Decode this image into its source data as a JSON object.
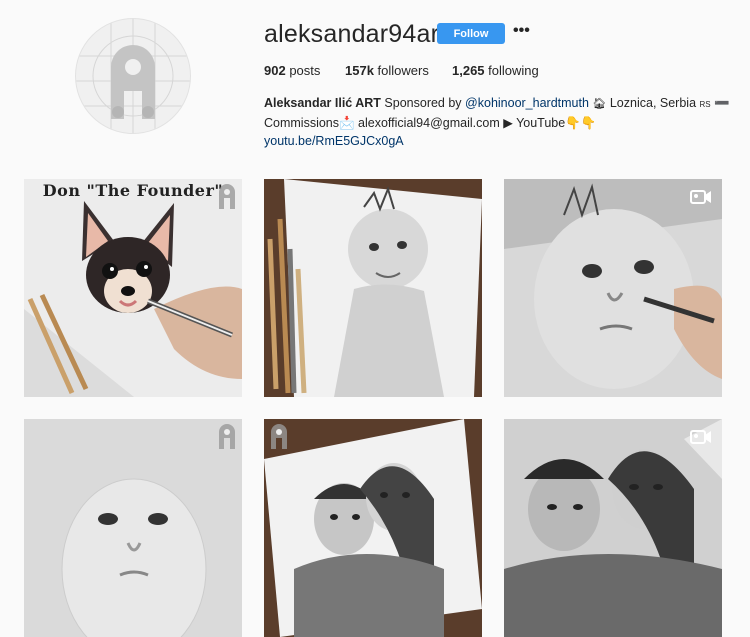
{
  "profile": {
    "username": "aleksandar94art",
    "follow_label": "Follow",
    "more_label": "•••",
    "stats": {
      "posts_count": "902",
      "posts_label": "posts",
      "followers_count": "157k",
      "followers_label": "followers",
      "following_count": "1,265",
      "following_label": "following"
    },
    "bio": {
      "name": "Aleksandar Ilić ART",
      "sponsored_text": "Sponsored by",
      "sponsor_tag": "@kohinoor_hardtmuth",
      "location": "Loznica, Serbia",
      "line2": "Commissions📩 alexofficial94@gmail.com ▶ YouTube👇👇",
      "link": "youtu.be/RmE5GJCx0gA"
    }
  },
  "posts": [
    {
      "type": "image",
      "subject": "chihuahua drawing",
      "caption": "Don \"The Founder\""
    },
    {
      "type": "image",
      "subject": "baby drawing with pencils",
      "caption": ""
    },
    {
      "type": "video",
      "subject": "baby face drawing",
      "caption": ""
    },
    {
      "type": "image",
      "subject": "baby face pencil drawing",
      "caption": ""
    },
    {
      "type": "image",
      "subject": "couple portrait drawing",
      "caption": ""
    },
    {
      "type": "video",
      "subject": "couple portrait drawing",
      "caption": ""
    }
  ],
  "colors": {
    "follow_button": "#3897f0",
    "link": "#003569",
    "background": "#fafafa"
  }
}
